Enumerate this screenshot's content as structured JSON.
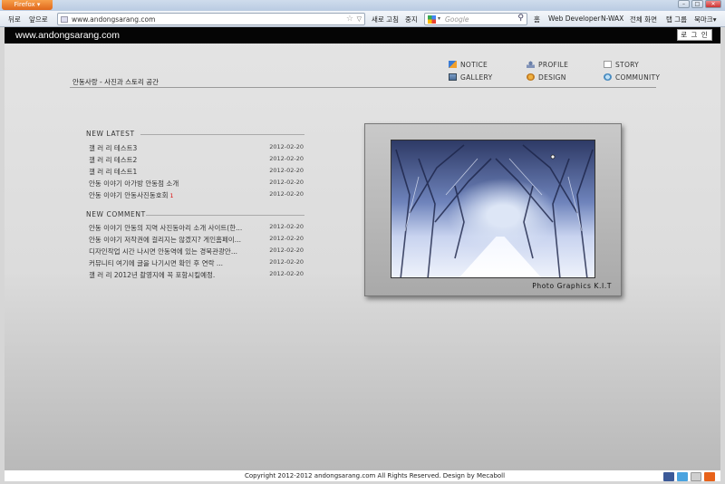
{
  "browser": {
    "app_button": "Firefox",
    "nav": {
      "back": "뒤로",
      "forward": "앞으로",
      "reload": "새로 고침",
      "stop": "중지",
      "home": "홈"
    },
    "url": "www.andongsarang.com",
    "search_placeholder": "Google",
    "bookmarks": [
      "Web Developer",
      "N-WAX",
      "전체 화면",
      "탭 그룹",
      "북마크"
    ]
  },
  "site": {
    "brand": "www.andongsarang.com",
    "login": "로 그 인",
    "subtitle": "안동사랑 - 사진과 스토리 공간",
    "menu": [
      {
        "label": "NOTICE",
        "icon": "notice-icon"
      },
      {
        "label": "PROFILE",
        "icon": "profile-icon"
      },
      {
        "label": "STORY",
        "icon": "story-icon"
      },
      {
        "label": "GALLERY",
        "icon": "gallery-icon"
      },
      {
        "label": "DESIGN",
        "icon": "design-icon"
      },
      {
        "label": "COMMUNITY",
        "icon": "community-icon"
      }
    ]
  },
  "latest": {
    "title": "NEW LATEST",
    "items": [
      {
        "text": "갤 러 리  테스트3",
        "date": "2012-02-20"
      },
      {
        "text": "갤 러 리  테스트2",
        "date": "2012-02-20"
      },
      {
        "text": "갤 러 리  테스트1",
        "date": "2012-02-20"
      },
      {
        "text": "안동 이야기  아가방 안동점 소개",
        "date": "2012-02-20"
      },
      {
        "text": "안동 이야기  안동사진동호회",
        "date": "2012-02-20",
        "badge": "1"
      }
    ]
  },
  "comments": {
    "title": "NEW COMMENT",
    "items": [
      {
        "text": "안동 이야기  안동의 지역 사진동아리 소개 사이트(한...",
        "date": "2012-02-20"
      },
      {
        "text": "안동 이야기  저작권에 걸리지는 않겠지? 게인홈페이...",
        "date": "2012-02-20"
      },
      {
        "text": "디자인작업  시간 나시면 안동역에 있는 경북관광안...",
        "date": "2012-02-20"
      },
      {
        "text": "커뮤니티  여기에 글을 나기시면 확인 후 연락 ...",
        "date": "2012-02-20"
      },
      {
        "text": "갤 러 리  2012년 촬영지에 꼭 포함시킬예정.",
        "date": "2012-02-20"
      }
    ]
  },
  "photo": {
    "caption": "Photo Graphics K.I.T"
  },
  "footer": {
    "text": "Copyright 2012-2012 andongsarang.com All Rights Reserved.    Design by Mecaboll"
  },
  "colors": {
    "topbar": "#050505",
    "page_bg": "#dcdcdc",
    "new_badge": "#dd0000"
  }
}
